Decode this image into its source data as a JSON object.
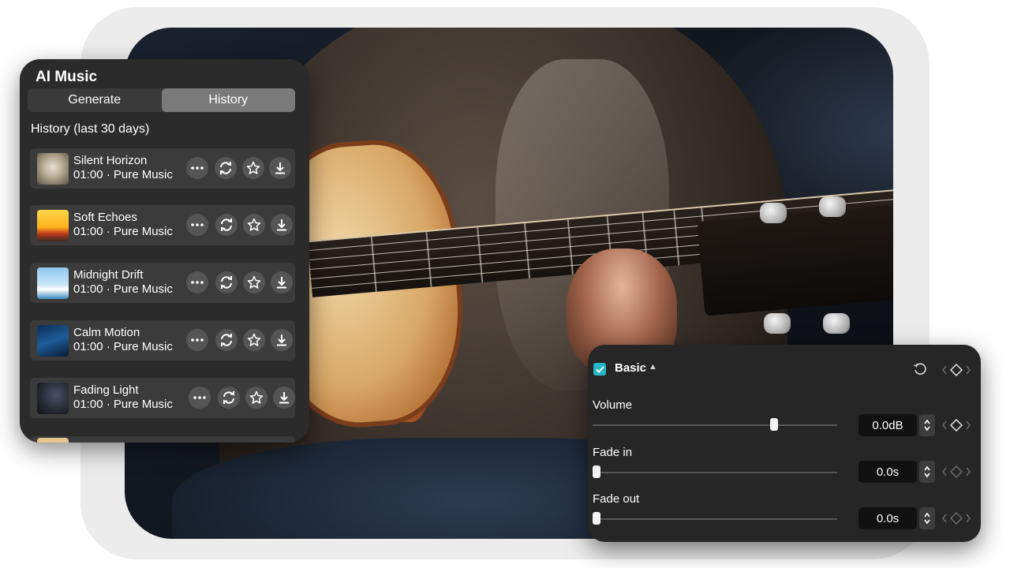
{
  "ai_music": {
    "title": "AI Music",
    "tabs": [
      {
        "label": "Generate",
        "active": false
      },
      {
        "label": "History",
        "active": true
      }
    ],
    "history_title": "History (last 30 days)",
    "tracks": [
      {
        "name": "Silent Horizon",
        "duration": "01:00",
        "genre": "Pure Music",
        "meta": "01:00 · Pure Music"
      },
      {
        "name": "Soft Echoes",
        "duration": "01:00",
        "genre": "Pure Music",
        "meta": "01:00 · Pure Music"
      },
      {
        "name": "Midnight Drift",
        "duration": "01:00",
        "genre": "Pure Music",
        "meta": "01:00 · Pure Music"
      },
      {
        "name": "Calm Motion",
        "duration": "01:00",
        "genre": "Pure Music",
        "meta": "01:00 · Pure Music"
      },
      {
        "name": "Fading Light",
        "duration": "01:00",
        "genre": "Pure Music",
        "meta": "01:00 · Pure Music"
      }
    ]
  },
  "basic": {
    "title": "Basic",
    "enabled": true,
    "params": [
      {
        "label": "Volume",
        "value": "0.0dB",
        "level": 0.75
      },
      {
        "label": "Fade in",
        "value": "0.0s",
        "level": 0
      },
      {
        "label": "Fade out",
        "value": "0.0s",
        "level": 0
      }
    ]
  },
  "colors": {
    "panel_bg": "#2b2b2b",
    "track_bg": "#3b3b3b",
    "active_tab": "#7a7a7a",
    "checkbox_accent": "#25b6c8"
  },
  "icons": {
    "track_actions": [
      "more-icon",
      "regenerate-icon",
      "star-icon",
      "download-icon"
    ],
    "basic_header": [
      "checkbox-icon",
      "caret-up-icon",
      "reset-icon",
      "keyframe-icon"
    ]
  }
}
